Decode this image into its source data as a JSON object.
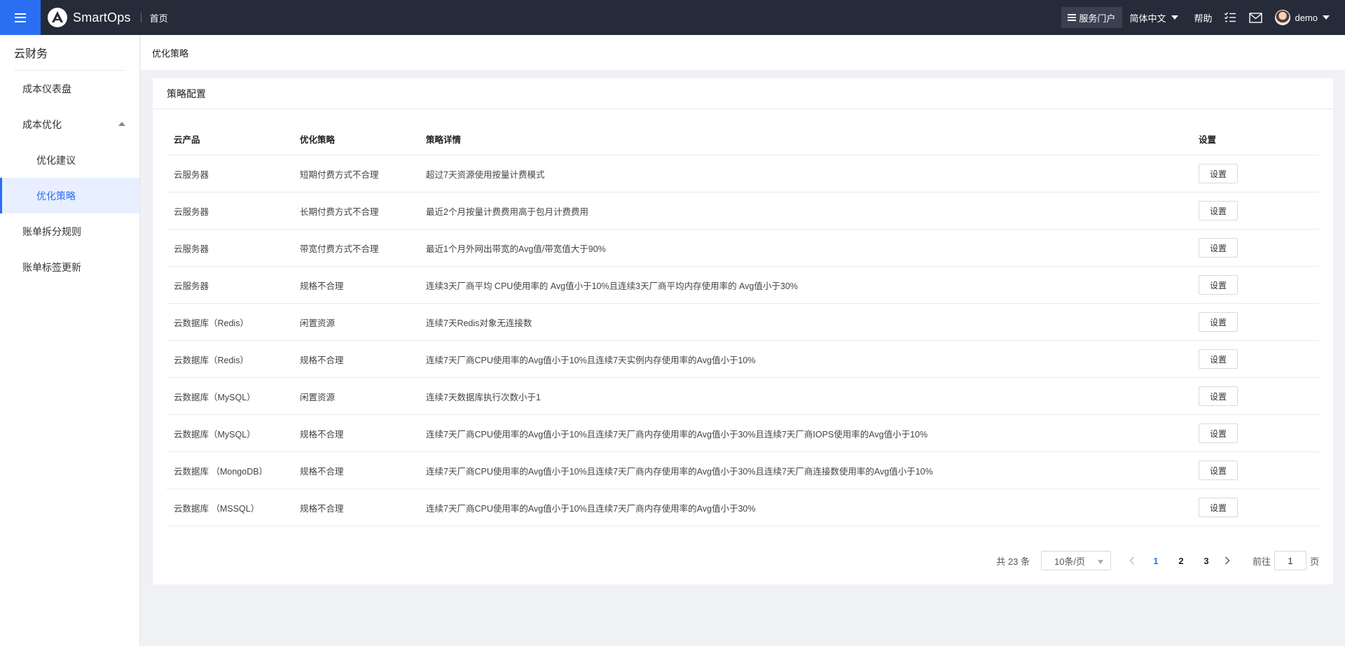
{
  "topbar": {
    "logo_text": "SmartOps",
    "home": "首页",
    "portal": "服务门户",
    "language": "简体中文",
    "help": "帮助",
    "user": "demo"
  },
  "sidebar": {
    "title": "云财务",
    "items": [
      {
        "label": "成本仪表盘"
      },
      {
        "label": "成本优化"
      },
      {
        "label": "优化建议"
      },
      {
        "label": "优化策略"
      },
      {
        "label": "账单拆分规则"
      },
      {
        "label": "账单标签更新"
      }
    ]
  },
  "breadcrumb": "优化策略",
  "card": {
    "title": "策略配置",
    "columns": [
      "云产品",
      "优化策略",
      "策略详情",
      "设置"
    ],
    "button_label": "设置",
    "rows": [
      {
        "product": "云服务器",
        "strategy": "短期付费方式不合理",
        "detail": "超过7天资源使用按量计费模式"
      },
      {
        "product": "云服务器",
        "strategy": "长期付费方式不合理",
        "detail": "最近2个月按量计费费用高于包月计费费用"
      },
      {
        "product": "云服务器",
        "strategy": "带宽付费方式不合理",
        "detail": "最近1个月外网出带宽的Avg值/带宽值大于90%"
      },
      {
        "product": "云服务器",
        "strategy": "规格不合理",
        "detail": "连续3天厂商平均 CPU使用率的 Avg值小于10%且连续3天厂商平均内存使用率的 Avg值小于30%"
      },
      {
        "product": "云数据库（Redis）",
        "strategy": "闲置资源",
        "detail": "连续7天Redis对象无连接数"
      },
      {
        "product": "云数据库（Redis）",
        "strategy": "规格不合理",
        "detail": "连续7天厂商CPU使用率的Avg值小于10%且连续7天实例内存使用率的Avg值小于10%"
      },
      {
        "product": "云数据库（MySQL）",
        "strategy": "闲置资源",
        "detail": "连续7天数据库执行次数小于1"
      },
      {
        "product": "云数据库（MySQL）",
        "strategy": "规格不合理",
        "detail": "连续7天厂商CPU使用率的Avg值小于10%且连续7天厂商内存使用率的Avg值小于30%且连续7天厂商IOPS使用率的Avg值小于10%"
      },
      {
        "product": "云数据库 （MongoDB）",
        "strategy": "规格不合理",
        "detail": "连续7天厂商CPU使用率的Avg值小于10%且连续7天厂商内存使用率的Avg值小于30%且连续7天厂商连接数使用率的Avg值小于10%"
      },
      {
        "product": "云数据库 （MSSQL）",
        "strategy": "规格不合理",
        "detail": "连续7天厂商CPU使用率的Avg值小于10%且连续7天厂商内存使用率的Avg值小于30%"
      }
    ]
  },
  "pagination": {
    "total": "共 23 条",
    "page_size": "10条/页",
    "pages": [
      "1",
      "2",
      "3"
    ],
    "current": "1",
    "goto_prefix": "前往",
    "goto_value": "1",
    "goto_suffix": "页"
  },
  "colors": {
    "accent": "#2a6ff2",
    "topbar": "#262b39"
  }
}
